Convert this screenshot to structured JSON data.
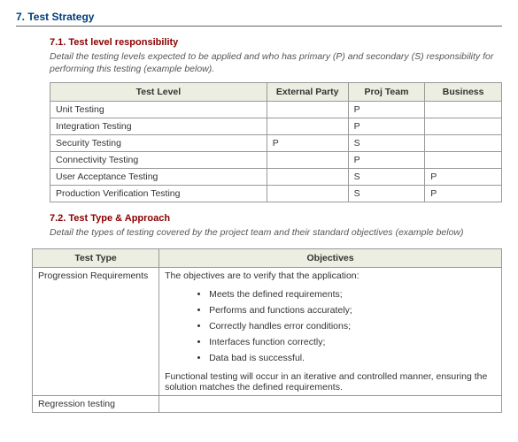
{
  "heading": "7. Test Strategy",
  "sub1": {
    "title": "7.1. Test level responsibility",
    "desc": "Detail the testing levels expected to be applied and who has primary (P) and secondary (S) responsibility for performing this testing (example below).",
    "headers": [
      "Test Level",
      "External Party",
      "Proj Team",
      "Business"
    ],
    "rows": [
      [
        "Unit Testing",
        "",
        "P",
        ""
      ],
      [
        "Integration Testing",
        "",
        "P",
        ""
      ],
      [
        "Security Testing",
        "P",
        "S",
        ""
      ],
      [
        "Connectivity Testing",
        "",
        "P",
        ""
      ],
      [
        "User Acceptance Testing",
        "",
        "S",
        "P"
      ],
      [
        "Production Verification Testing",
        "",
        "S",
        "P"
      ]
    ]
  },
  "sub2": {
    "title": "7.2. Test Type & Approach",
    "desc": "Detail the types of testing covered by the project team and their standard objectives (example below)",
    "headers": [
      "Test Type",
      "Objectives"
    ],
    "row1_type": "Progression Requirements",
    "obj_intro": "The objectives are to verify that the application:",
    "obj_items": [
      "Meets the defined requirements;",
      "Performs and functions accurately;",
      "Correctly handles error conditions;",
      "Interfaces function correctly;",
      "Data bad is successful."
    ],
    "obj_footer": "Functional testing will occur in an iterative and controlled manner, ensuring the solution matches the defined requirements.",
    "row2_type": "Regression testing"
  }
}
